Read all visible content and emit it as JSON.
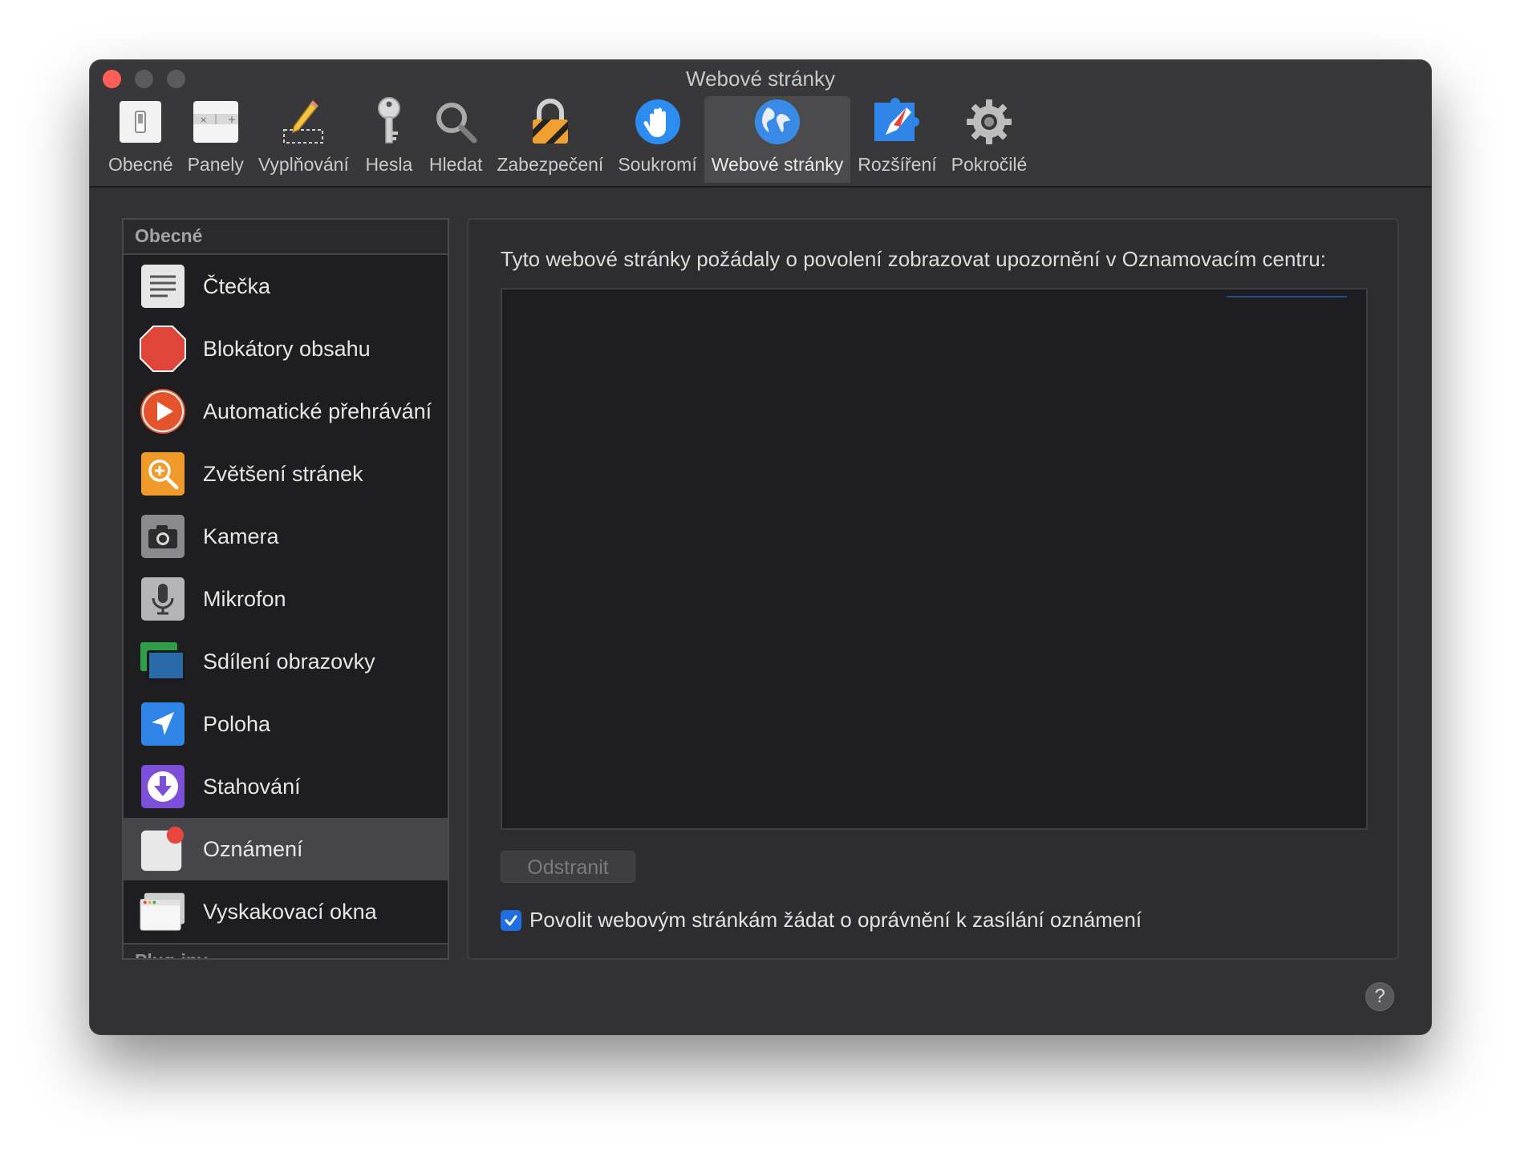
{
  "window": {
    "title": "Webové stránky"
  },
  "toolbar": {
    "items": [
      {
        "label": "Obecné",
        "icon": "general-switch-icon",
        "selected": false
      },
      {
        "label": "Panely",
        "icon": "tabs-icon",
        "selected": false
      },
      {
        "label": "Vyplňování",
        "icon": "pencil-icon",
        "selected": false
      },
      {
        "label": "Hesla",
        "icon": "key-icon",
        "selected": false
      },
      {
        "label": "Hledat",
        "icon": "magnifier-icon",
        "selected": false
      },
      {
        "label": "Zabezpečení",
        "icon": "padlock-icon",
        "selected": false
      },
      {
        "label": "Soukromí",
        "icon": "hand-icon",
        "selected": false
      },
      {
        "label": "Webové stránky",
        "icon": "globe-icon",
        "selected": true
      },
      {
        "label": "Rozšíření",
        "icon": "puzzle-compass-icon",
        "selected": false
      },
      {
        "label": "Pokročilé",
        "icon": "gear-icon",
        "selected": false
      }
    ]
  },
  "sidebar": {
    "header": "Obecné",
    "footer_header": "Plug-iny",
    "items": [
      {
        "label": "Čtečka",
        "icon": "reader-icon",
        "selected": false
      },
      {
        "label": "Blokátory obsahu",
        "icon": "stop-sign-icon",
        "selected": false
      },
      {
        "label": "Automatické přehrávání",
        "icon": "play-icon",
        "selected": false
      },
      {
        "label": "Zvětšení stránek",
        "icon": "zoom-icon",
        "selected": false
      },
      {
        "label": "Kamera",
        "icon": "camera-icon",
        "selected": false
      },
      {
        "label": "Mikrofon",
        "icon": "microphone-icon",
        "selected": false
      },
      {
        "label": "Sdílení obrazovky",
        "icon": "screen-sharing-icon",
        "selected": false
      },
      {
        "label": "Poloha",
        "icon": "location-arrow-icon",
        "selected": false
      },
      {
        "label": "Stahování",
        "icon": "download-icon",
        "selected": false
      },
      {
        "label": "Oznámení",
        "icon": "notification-badge-icon",
        "selected": true
      },
      {
        "label": "Vyskakovací okna",
        "icon": "popup-window-icon",
        "selected": false
      }
    ]
  },
  "main": {
    "description": "Tyto webové stránky požádaly o povolení zobrazovat upozornění v Oznamovacím centru:",
    "remove_button": "Odstranit",
    "allow_checkbox": {
      "label": "Povolit webovým stránkám žádat o oprávnění k zasílání oznámení",
      "checked": true
    },
    "help": "?"
  },
  "colors": {
    "accent": "#1f6fe3",
    "close": "#ff5f57",
    "window_bg": "#323235"
  }
}
